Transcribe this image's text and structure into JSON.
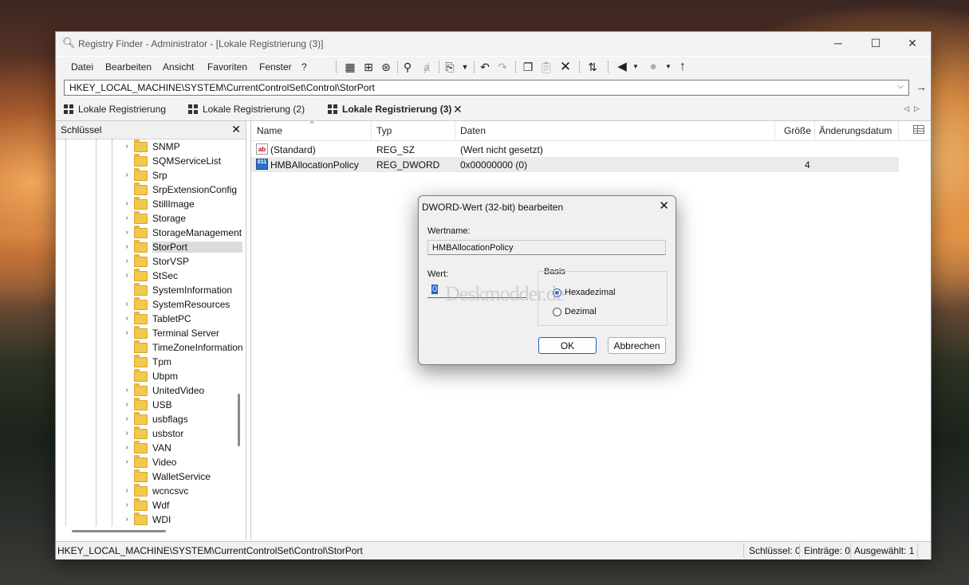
{
  "window": {
    "title": "Registry Finder - Administrator - [Lokale Registrierung (3)]",
    "minimize": "─",
    "maximize": "☐",
    "close": "✕"
  },
  "menu": [
    "Datei",
    "Bearbeiten",
    "Ansicht",
    "Favoriten",
    "Fenster",
    "?"
  ],
  "toolbar_icons": [
    "new-tab-icon",
    "find-key-icon",
    "refresh-icon",
    "find-icon",
    "replace-icon",
    "export-icon",
    "dropdown-icon",
    "undo-icon",
    "redo-icon",
    "copy-icon",
    "paste-icon",
    "delete-icon",
    "jump-icon",
    "back-icon",
    "back-dropdown-icon",
    "forward-icon",
    "forward-dropdown-icon",
    "up-icon"
  ],
  "address": {
    "path": "HKEY_LOCAL_MACHINE\\SYSTEM\\CurrentControlSet\\Control\\StorPort"
  },
  "tabs": [
    {
      "label": "Lokale Registrierung"
    },
    {
      "label": "Lokale Registrierung (2)"
    },
    {
      "label": "Lokale Registrierung (3)",
      "active": true
    }
  ],
  "left_pane": {
    "title": "Schlüssel",
    "items": [
      {
        "label": "SNMP",
        "expandable": true
      },
      {
        "label": "SQMServiceList",
        "expandable": false
      },
      {
        "label": "Srp",
        "expandable": true
      },
      {
        "label": "SrpExtensionConfig",
        "expandable": false
      },
      {
        "label": "StillImage",
        "expandable": true
      },
      {
        "label": "Storage",
        "expandable": true
      },
      {
        "label": "StorageManagement",
        "expandable": true
      },
      {
        "label": "StorPort",
        "expandable": true,
        "selected": true
      },
      {
        "label": "StorVSP",
        "expandable": true
      },
      {
        "label": "StSec",
        "expandable": true
      },
      {
        "label": "SystemInformation",
        "expandable": false
      },
      {
        "label": "SystemResources",
        "expandable": true
      },
      {
        "label": "TabletPC",
        "expandable": true
      },
      {
        "label": "Terminal Server",
        "expandable": true
      },
      {
        "label": "TimeZoneInformation",
        "expandable": false
      },
      {
        "label": "Tpm",
        "expandable": false
      },
      {
        "label": "Ubpm",
        "expandable": false
      },
      {
        "label": "UnitedVideo",
        "expandable": true
      },
      {
        "label": "USB",
        "expandable": true
      },
      {
        "label": "usbflags",
        "expandable": true
      },
      {
        "label": "usbstor",
        "expandable": true
      },
      {
        "label": "VAN",
        "expandable": true
      },
      {
        "label": "Video",
        "expandable": true
      },
      {
        "label": "WalletService",
        "expandable": false
      },
      {
        "label": "wcncsvc",
        "expandable": true
      },
      {
        "label": "Wdf",
        "expandable": true
      },
      {
        "label": "WDI",
        "expandable": true
      }
    ]
  },
  "columns": {
    "name": "Name",
    "type": "Typ",
    "data": "Daten",
    "size": "Größe",
    "modified": "Änderungsdatum"
  },
  "values": [
    {
      "icon": "ab",
      "name": "(Standard)",
      "type": "REG_SZ",
      "data": "(Wert nicht gesetzt)",
      "size": ""
    },
    {
      "icon": "011",
      "name": "HMBAllocationPolicy",
      "type": "REG_DWORD",
      "data": "0x00000000 (0)",
      "size": "4"
    }
  ],
  "status": {
    "path": "HKEY_LOCAL_MACHINE\\SYSTEM\\CurrentControlSet\\Control\\StorPort",
    "keys": "Schlüssel: 0",
    "entries": "Einträge: 0",
    "selected": "Ausgewählt: 1"
  },
  "dialog": {
    "title": "DWORD-Wert (32-bit) bearbeiten",
    "close": "✕",
    "name_label": "Wertname:",
    "name_value": "HMBAllocationPolicy",
    "value_label": "Wert:",
    "value": "0",
    "basis_label": "Basis",
    "hex_label": "Hexadezimal",
    "dec_label": "Dezimal",
    "ok": "OK",
    "cancel": "Abbrechen",
    "watermark": "Deskmodder.de"
  }
}
